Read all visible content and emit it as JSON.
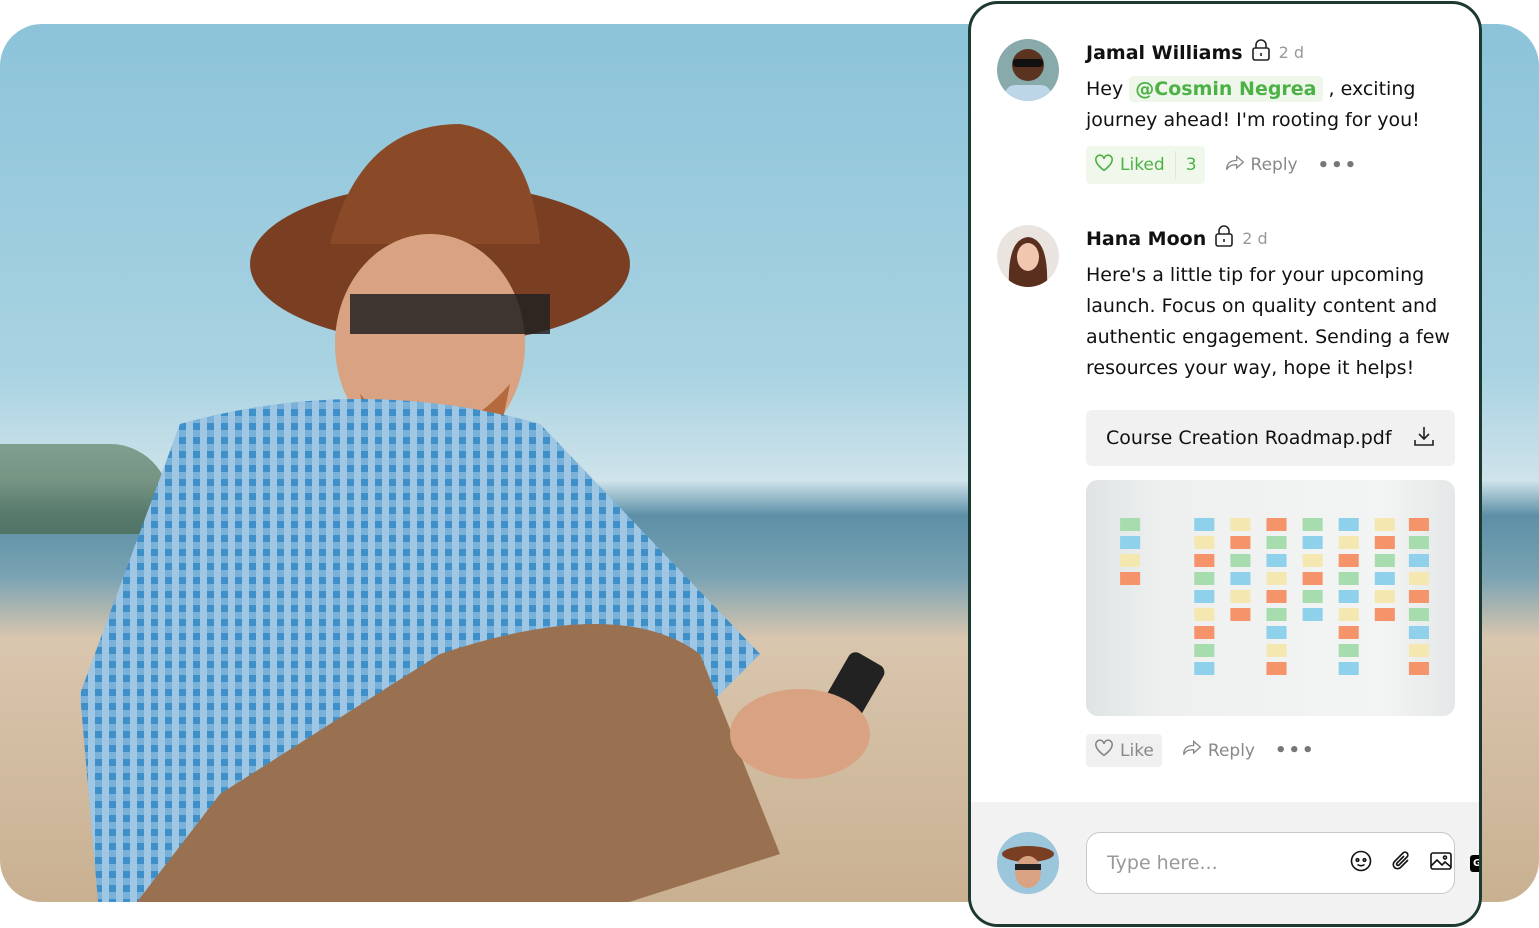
{
  "comments": [
    {
      "author": "Jamal Williams",
      "time": "2 d",
      "text_before": "Hey",
      "mention": "@Cosmin Negrea",
      "text_after": ", exciting journey ahead! I'm rooting for you!",
      "like_label": "Liked",
      "like_count": "3",
      "reply_label": "Reply",
      "liked": true
    },
    {
      "author": "Hana Moon",
      "time": "2 d",
      "text": "Here's a little tip for your upcoming launch. Focus on quality content and authentic engagement. Sending a few resources your way, hope it helps!",
      "attachment": "Course Creation Roadmap.pdf",
      "like_label": "Like",
      "reply_label": "Reply",
      "liked": false
    }
  ],
  "composer": {
    "placeholder": "Type here...",
    "gif_label": "GIF"
  },
  "colors": {
    "accent": "#4cb246",
    "border": "#1d3a32"
  }
}
